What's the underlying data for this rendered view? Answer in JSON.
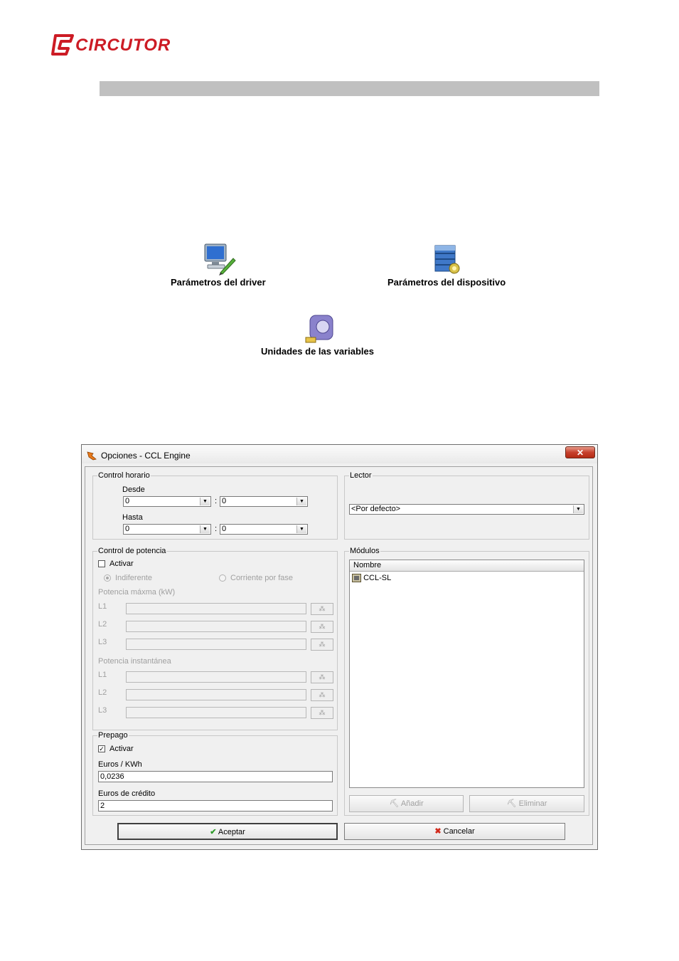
{
  "page": {
    "logo_text": "CIRCUTOR",
    "icons": [
      {
        "icon": "monitor-pencil-icon",
        "label": "Parámetros del driver"
      },
      {
        "icon": "server-database-icon",
        "label": "Parámetros del dispositivo"
      },
      {
        "icon": "measuring-tape-icon",
        "label": "Unidades de las variables"
      }
    ]
  },
  "dialog": {
    "title": "Opciones - CCL Engine",
    "close_label": "✕",
    "control_horario": {
      "legend": "Control horario",
      "desde_label": "Desde",
      "hasta_label": "Hasta",
      "desde_h": "0",
      "desde_m": "0",
      "hasta_h": "0",
      "hasta_m": "0",
      "separator": ":"
    },
    "lector": {
      "legend": "Lector",
      "value": "<Por defecto>"
    },
    "control_potencia": {
      "legend": "Control de potencia",
      "activar_label": "Activar",
      "activar_checked": false,
      "radio_indiferente": "Indiferente",
      "radio_corriente": "Corriente por fase",
      "maxima_label": "Potencia máxma (kW)",
      "instantanea_label": "Potencia instantánea",
      "phases": [
        "L1",
        "L2",
        "L3"
      ]
    },
    "prepago": {
      "legend": "Prepago",
      "activar_label": "Activar",
      "activar_checked": true,
      "check_mark": "✓",
      "euros_kwh_label": "Euros / KWh",
      "euros_kwh_value": "0,0236",
      "euros_credito_label": "Euros de crédito",
      "euros_credito_value": "2"
    },
    "modulos": {
      "legend": "Módulos",
      "column_header": "Nombre",
      "items": [
        "CCL-SL"
      ],
      "add_label": "Añadir",
      "remove_label": "Eliminar"
    },
    "ok_label": "Aceptar",
    "cancel_label": "Cancelar"
  },
  "colors": {
    "brand": "#cc1b24",
    "header_bar": "#c0c0c0",
    "dialog_bg": "#f0f0f0",
    "close_button": "#c7412d"
  }
}
